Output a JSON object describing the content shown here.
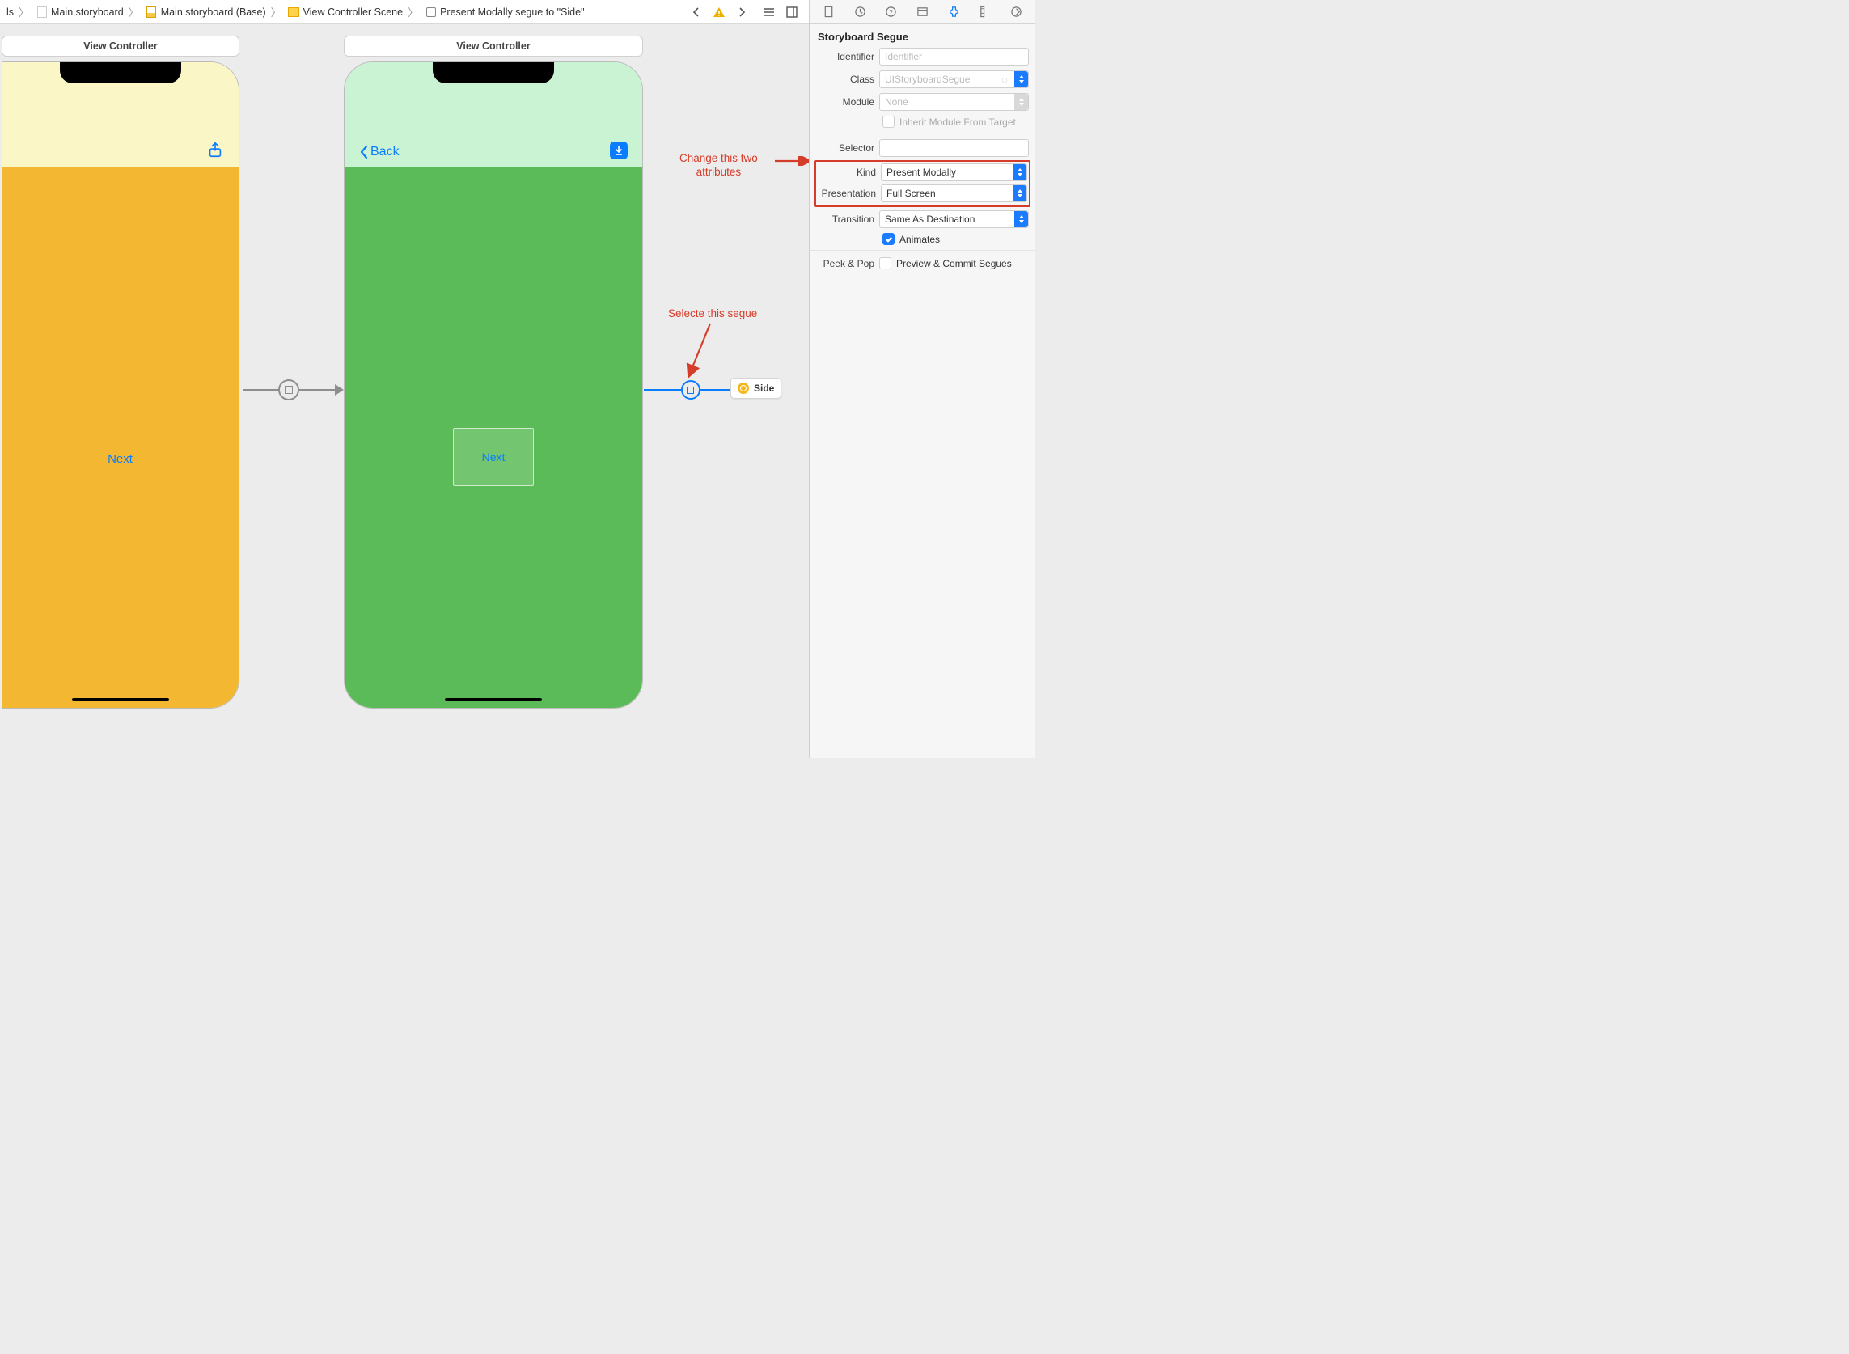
{
  "breadcrumb": {
    "item0_suffix": "ls",
    "item1": "Main.storyboard",
    "item2": "Main.storyboard (Base)",
    "item3": "View Controller Scene",
    "item4": "Present Modally segue to \"Side\""
  },
  "scene1": {
    "title": "View Controller",
    "next_label": "Next"
  },
  "scene2": {
    "title": "View Controller",
    "back_label": "Back",
    "next_label": "Next"
  },
  "side_ref": {
    "label": "Side"
  },
  "annotations": {
    "select_segue": "Selecte this segue",
    "change_attrs_l1": "Change this two",
    "change_attrs_l2": "attributes"
  },
  "inspector": {
    "section_title": "Storyboard Segue",
    "identifier_label": "Identifier",
    "identifier_placeholder": "Identifier",
    "class_label": "Class",
    "class_placeholder": "UIStoryboardSegue",
    "module_label": "Module",
    "module_placeholder": "None",
    "inherit_label": "Inherit Module From Target",
    "selector_label": "Selector",
    "kind_label": "Kind",
    "kind_value": "Present Modally",
    "presentation_label": "Presentation",
    "presentation_value": "Full Screen",
    "transition_label": "Transition",
    "transition_value": "Same As Destination",
    "animates_label": "Animates",
    "peekpop_label": "Peek & Pop",
    "peekpop_value": "Preview & Commit Segues"
  }
}
